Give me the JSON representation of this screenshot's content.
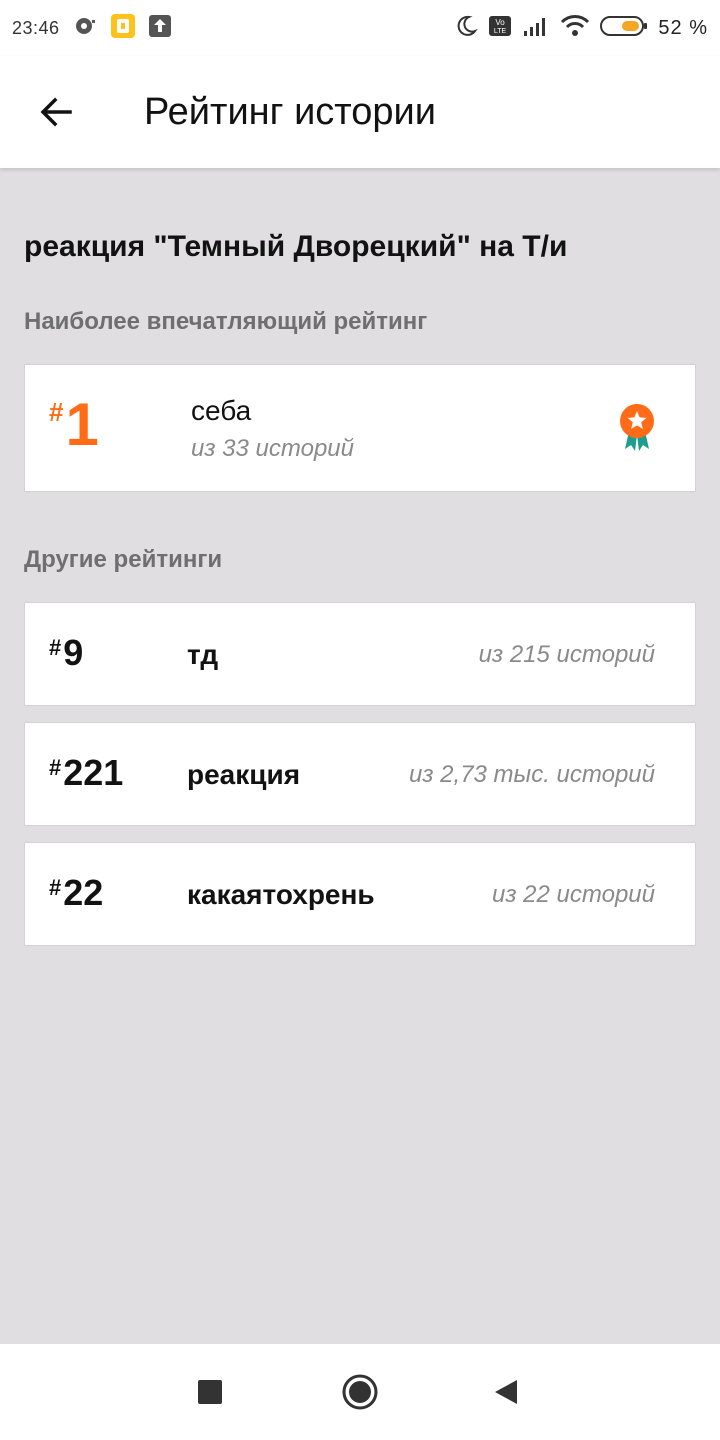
{
  "status_bar": {
    "time": "23:46",
    "battery": "52 %"
  },
  "app_bar": {
    "title": "Рейтинг истории"
  },
  "story": {
    "title": "реакция \"Темный Дворецкий\" на Т/и"
  },
  "top_section": {
    "label": "Наиболее впечатляющий рейтинг",
    "rank_hash": "#",
    "rank": "1",
    "tag": "себа",
    "subtitle": "из 33 историй"
  },
  "other_section": {
    "label": "Другие рейтинги",
    "items": [
      {
        "hash": "#",
        "rank": "9",
        "tag": "тд",
        "subtitle": "из 215 историй"
      },
      {
        "hash": "#",
        "rank": "221",
        "tag": "реакция",
        "subtitle": "из 2,73 тыс. историй"
      },
      {
        "hash": "#",
        "rank": "22",
        "tag": "какаятохрень",
        "subtitle": "из 22 историй"
      }
    ]
  },
  "colors": {
    "accent": "#ff6b17",
    "badge_ribbon": "#1f9e8f",
    "background": "#e0dee1"
  }
}
